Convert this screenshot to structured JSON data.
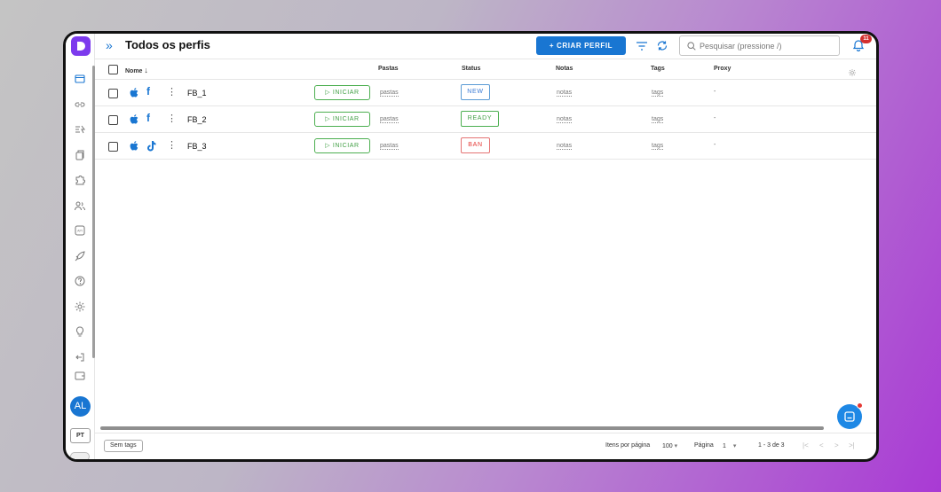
{
  "header": {
    "title": "Todos os perfis",
    "create_label": "+ CRIAR PERFIL",
    "search_placeholder": "Pesquisar (pressione /)",
    "notifications_count": "11"
  },
  "table": {
    "columns": {
      "name": "Nome",
      "folders": "Pastas",
      "status": "Status",
      "notes": "Notas",
      "tags": "Tags",
      "proxy": "Proxy"
    },
    "start_label": "▷ INICIAR",
    "rows": [
      {
        "name": "FB_1",
        "platform_icon": "facebook-icon",
        "folders": "pastas",
        "status": "NEW",
        "notes": "notas",
        "tags": "tags",
        "proxy": "-"
      },
      {
        "name": "FB_2",
        "platform_icon": "facebook-icon",
        "folders": "pastas",
        "status": "READY",
        "notes": "notas",
        "tags": "tags",
        "proxy": "-"
      },
      {
        "name": "FB_3",
        "platform_icon": "tiktok-icon",
        "folders": "pastas",
        "status": "BAN",
        "notes": "notas",
        "tags": "tags",
        "proxy": "-"
      }
    ]
  },
  "sidebar": {
    "avatar_initials": "AL",
    "language": "PT",
    "icons": [
      "browser-icon",
      "link-icon",
      "broadcast-icon",
      "copy-icon",
      "extension-icon",
      "users-icon",
      "api-icon",
      "rocket-icon",
      "help-icon",
      "settings-icon",
      "lightbulb-icon",
      "logout-icon",
      "wallet-icon"
    ]
  },
  "footer": {
    "tag_chip": "Sem tags",
    "items_per_page_label": "Itens por página",
    "items_per_page_value": "100",
    "page_label": "Página",
    "page_value": "1",
    "range": "1 - 3 de 3",
    "first": "|<",
    "prev": "<",
    "next": ">",
    "last": ">|"
  },
  "colors": {
    "accent": "#1976d2",
    "ready": "#43a047",
    "ban": "#e53935",
    "logo": "#7c3aed"
  }
}
